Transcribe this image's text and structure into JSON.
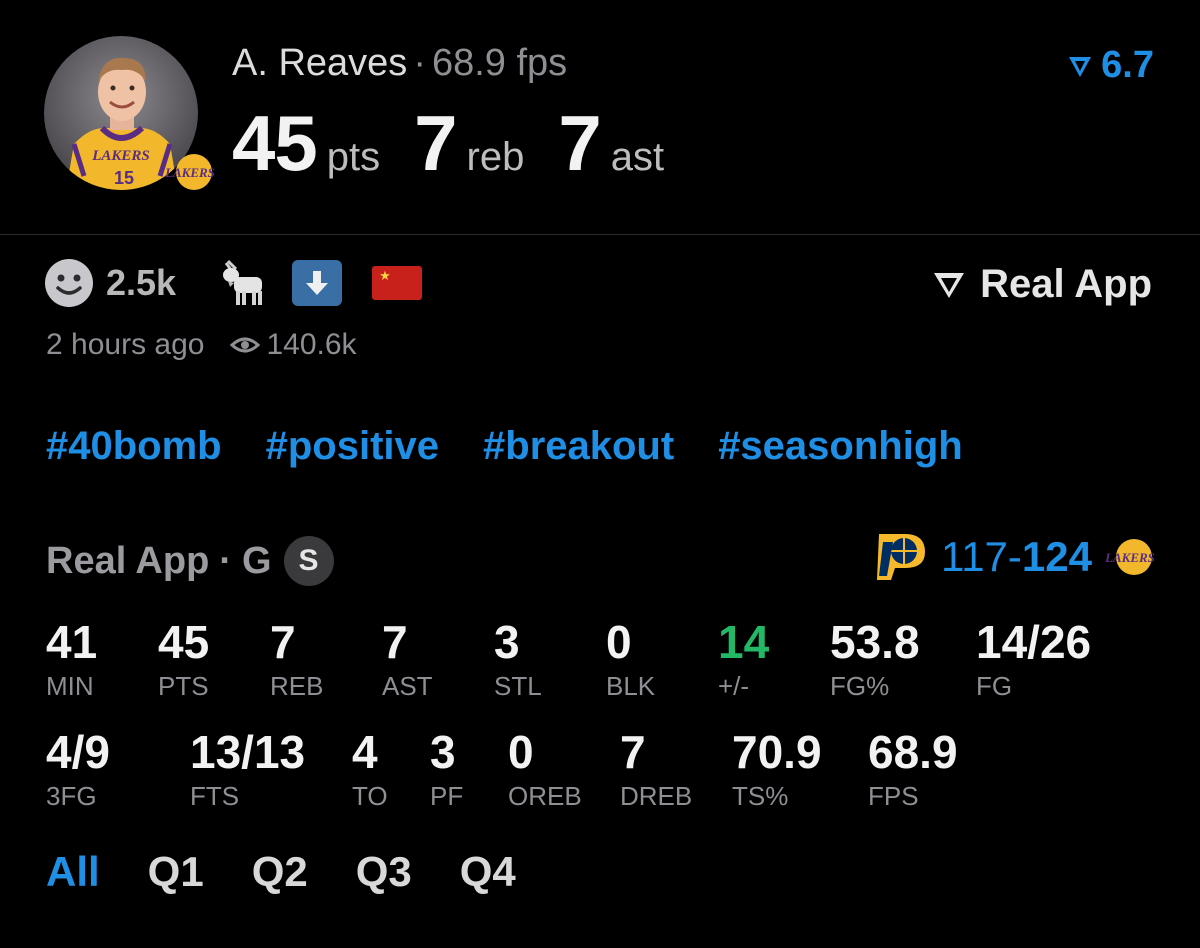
{
  "player": {
    "name": "A. Reaves",
    "separator": "·",
    "fps": "68.9 fps",
    "pts": "45",
    "pts_unit": "pts",
    "reb": "7",
    "reb_unit": "reb",
    "ast": "7",
    "ast_unit": "ast",
    "jersey_text": "LAKERS",
    "jersey_number": "15",
    "team_badge_text": "LAKERS"
  },
  "header": {
    "rating": "6.7",
    "rating_icon": "real-app-logo-icon"
  },
  "reactions": {
    "count": "2.5k",
    "icons": [
      "smiley-icon",
      "goat-icon",
      "down-arrow-icon",
      "china-flag-icon"
    ]
  },
  "brand": {
    "label": "Real App"
  },
  "meta": {
    "time": "2 hours ago",
    "views": "140.6k"
  },
  "tags": [
    "#40bomb",
    "#positive",
    "#breakout",
    "#seasonhigh"
  ],
  "game": {
    "source": "Real App",
    "separator": "·",
    "position": "G",
    "badge": "S",
    "score_left": "117",
    "score_dash": "-",
    "score_right": "124"
  },
  "stats_row1": [
    {
      "value": "41",
      "label": "MIN"
    },
    {
      "value": "45",
      "label": "PTS"
    },
    {
      "value": "7",
      "label": "REB"
    },
    {
      "value": "7",
      "label": "AST"
    },
    {
      "value": "3",
      "label": "STL"
    },
    {
      "value": "0",
      "label": "BLK"
    },
    {
      "value": "14",
      "label": "+/-"
    },
    {
      "value": "53.8",
      "label": "FG%"
    },
    {
      "value": "14/26",
      "label": "FG"
    }
  ],
  "stats_row2": [
    {
      "value": "4/9",
      "label": "3FG"
    },
    {
      "value": "13/13",
      "label": "FTS"
    },
    {
      "value": "4",
      "label": "TO"
    },
    {
      "value": "3",
      "label": "PF"
    },
    {
      "value": "0",
      "label": "OREB"
    },
    {
      "value": "7",
      "label": "DREB"
    },
    {
      "value": "70.9",
      "label": "TS%"
    },
    {
      "value": "68.9",
      "label": "FPS"
    }
  ],
  "quarters": [
    "All",
    "Q1",
    "Q2",
    "Q3",
    "Q4"
  ],
  "colors": {
    "accent": "#1f8fe5",
    "positive": "#23b866",
    "background": "#000000",
    "muted": "#8e8e93"
  }
}
